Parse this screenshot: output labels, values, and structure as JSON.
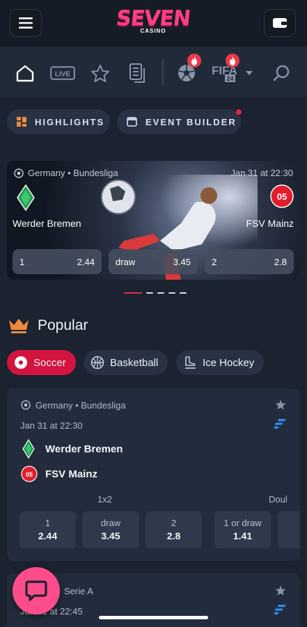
{
  "header": {
    "logo_text": "SEVEN",
    "logo_sub": "CASINO",
    "menu_icon": "hamburger-icon",
    "wallet_icon": "wallet-icon"
  },
  "sport_nav": {
    "items": [
      {
        "name": "home",
        "icon": "home-icon"
      },
      {
        "name": "live",
        "label": "LIVE",
        "icon": "live-icon"
      },
      {
        "name": "favorites",
        "icon": "star-icon"
      },
      {
        "name": "betslip",
        "icon": "document-icon"
      },
      {
        "name": "soccer",
        "icon": "soccer-ball-icon",
        "hot": true
      },
      {
        "name": "fifa",
        "label": "FIFA",
        "sub": "24",
        "icon": "fifa-icon",
        "hot": true
      },
      {
        "name": "search",
        "icon": "search-icon"
      }
    ]
  },
  "pills": {
    "highlights": "HIGHLIGHTS",
    "event_builder": "EVENT BUILDER"
  },
  "hero": {
    "league": "Germany • Bundesliga",
    "datetime": "Jan 31 at 22:30",
    "home": "Werder Bremen",
    "away": "FSV Mainz",
    "odds": [
      {
        "label": "1",
        "value": "2.44"
      },
      {
        "label": "draw",
        "value": "3.45"
      },
      {
        "label": "2",
        "value": "2.8"
      }
    ],
    "carousel_active": 1,
    "carousel_count": 5
  },
  "popular": {
    "title": "Popular",
    "tabs": [
      {
        "label": "Soccer",
        "active": true
      },
      {
        "label": "Basketball",
        "active": false
      },
      {
        "label": "Ice Hockey",
        "active": false
      }
    ]
  },
  "match_card": {
    "league": "Germany • Bundesliga",
    "datetime": "Jan 31 at 22:30",
    "home": "Werder Bremen",
    "away": "FSV Mainz",
    "market_1x2": "1x2",
    "market_double": "Doul",
    "odds": [
      {
        "label": "1",
        "value": "2.44"
      },
      {
        "label": "draw",
        "value": "3.45"
      },
      {
        "label": "2",
        "value": "2.8"
      },
      {
        "label": "1 or draw",
        "value": "1.41"
      }
    ]
  },
  "match_card_2": {
    "league": "Serie A",
    "datetime": "Jan 31 at 22:45"
  },
  "colors": {
    "accent": "#d3143e",
    "background": "#1b2230",
    "brand_pink": "#ff4c8b"
  }
}
